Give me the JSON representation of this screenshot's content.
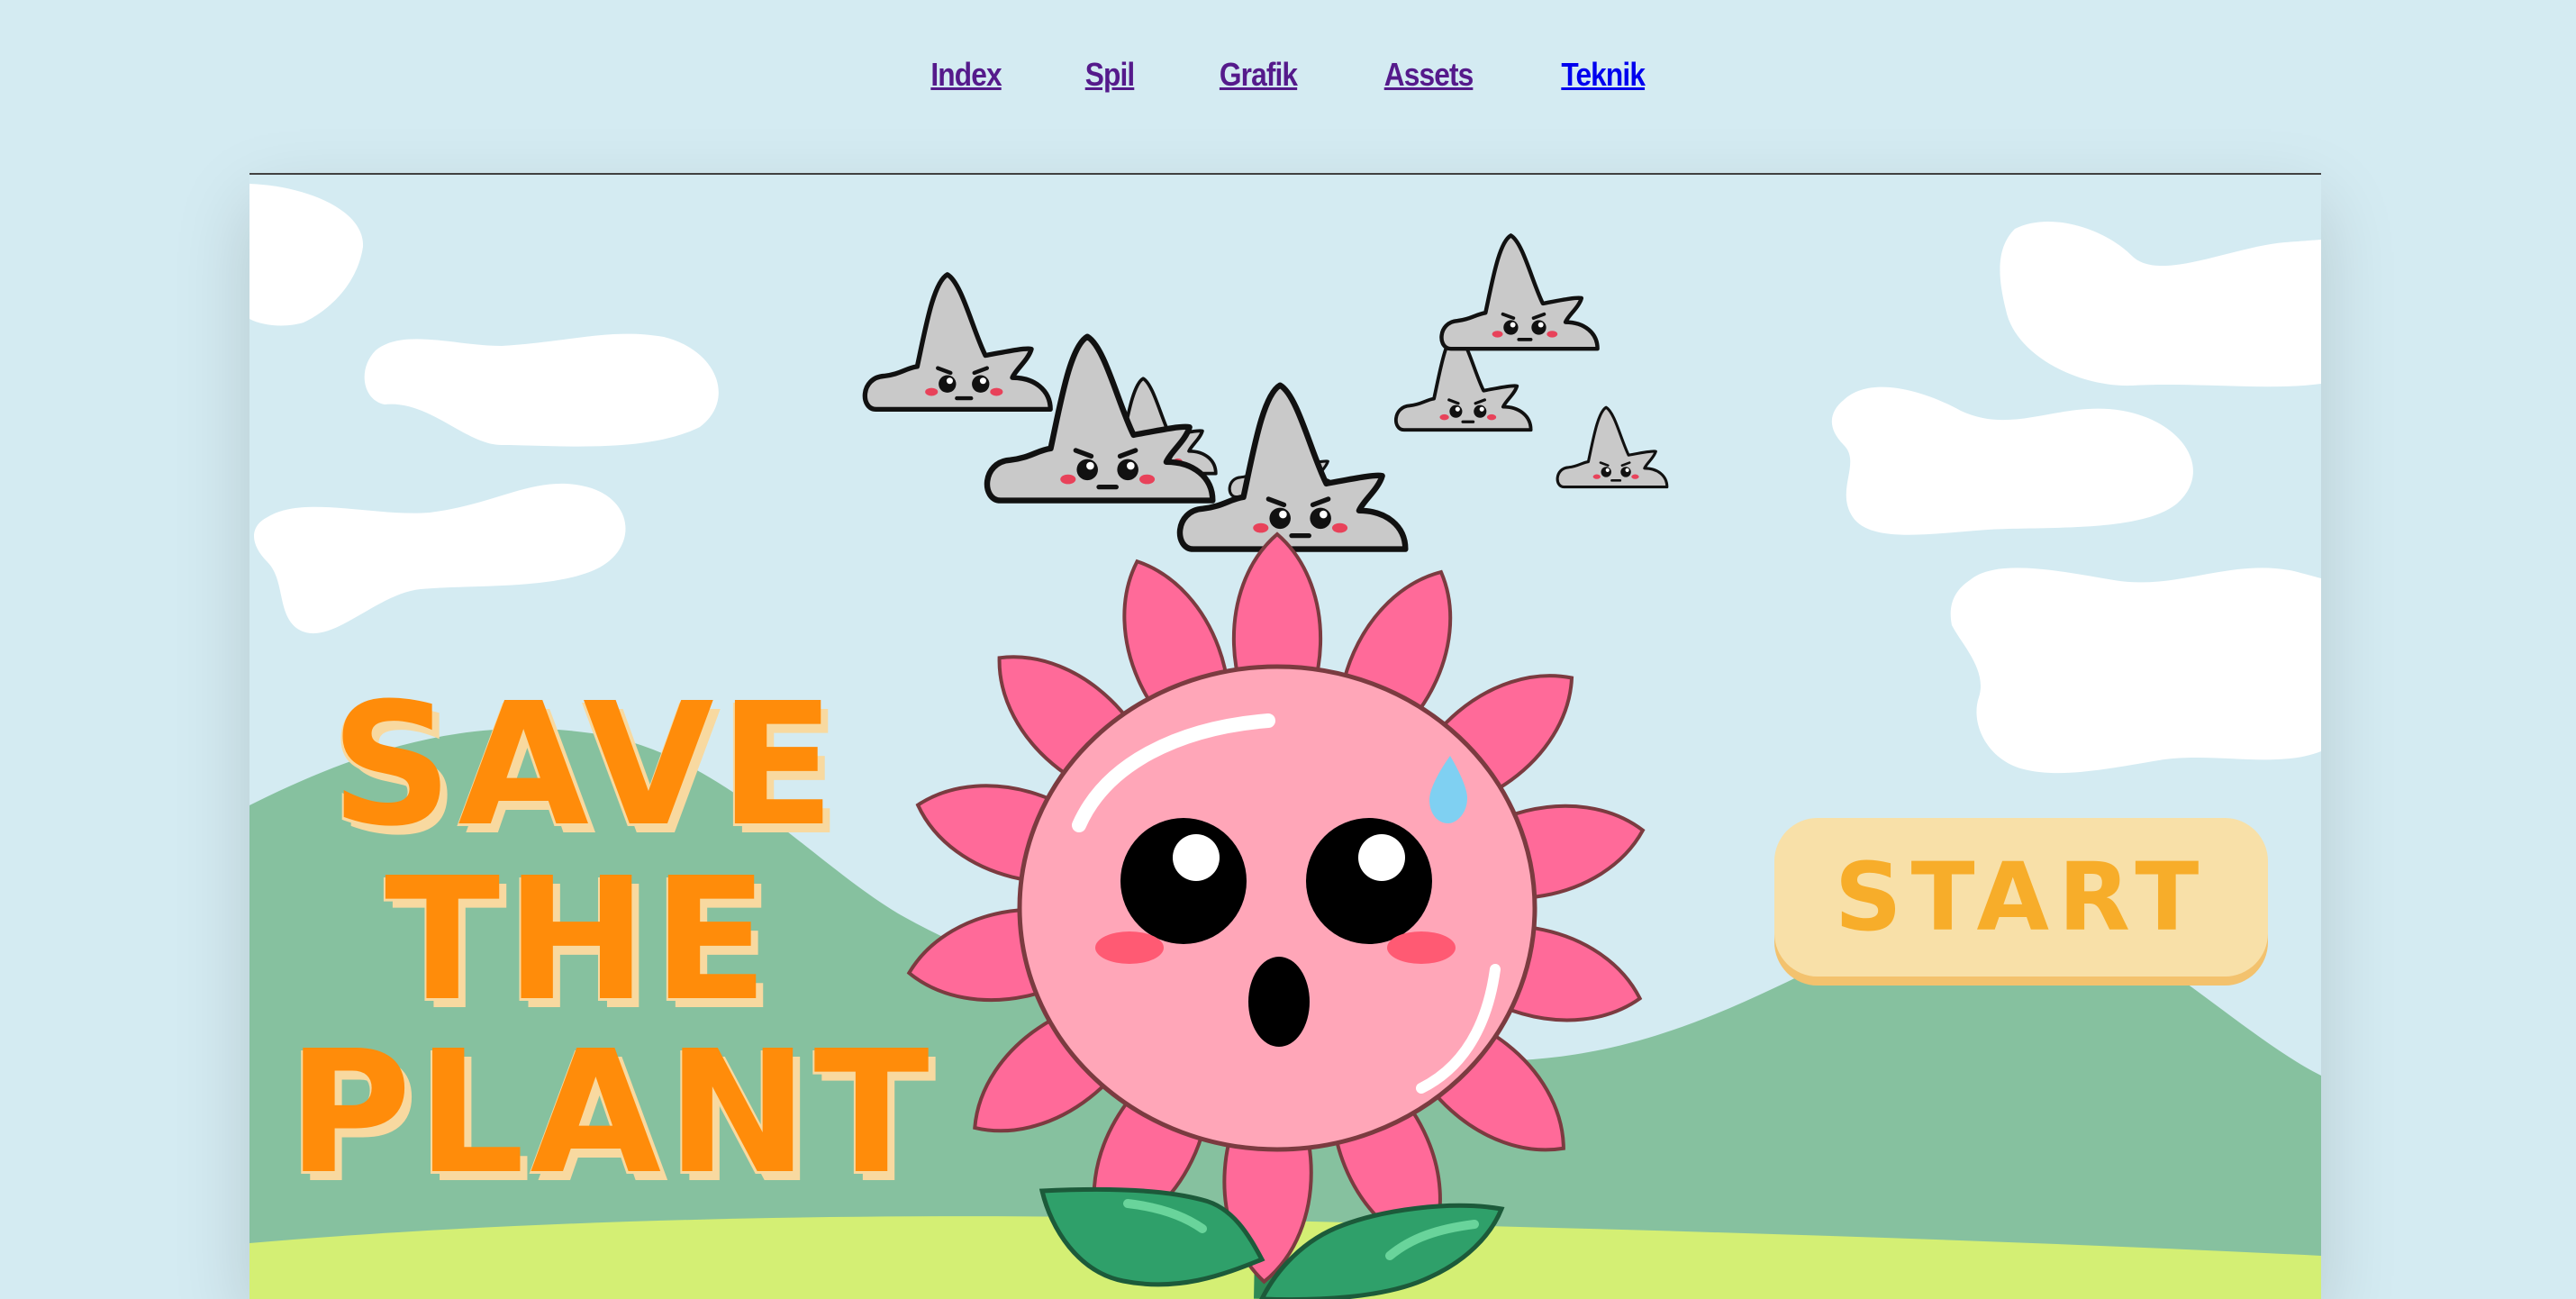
{
  "nav": {
    "items": [
      {
        "label": "Index"
      },
      {
        "label": "Spil"
      },
      {
        "label": "Grafik"
      },
      {
        "label": "Assets"
      },
      {
        "label": "Teknik"
      }
    ]
  },
  "game": {
    "title_lines": [
      "SAVE",
      "THE",
      "PLANT"
    ],
    "start_label": "START"
  },
  "colors": {
    "sky": "#d4ebf2",
    "hills": "#86c19f",
    "grass": "#d4ef74",
    "title": "#ff8c0a",
    "title_shadow": "#f8d9a0",
    "start_button": "#f8e0a8",
    "start_text": "#f7ad2a",
    "petals": "#ff6a99",
    "flower_face": "#ffa6b8",
    "storm_cloud": "#c9c9c9"
  },
  "icons": [
    "storm-cloud-icon",
    "cloud-icon",
    "flower-character",
    "water-drop-icon",
    "leaf-icon"
  ]
}
